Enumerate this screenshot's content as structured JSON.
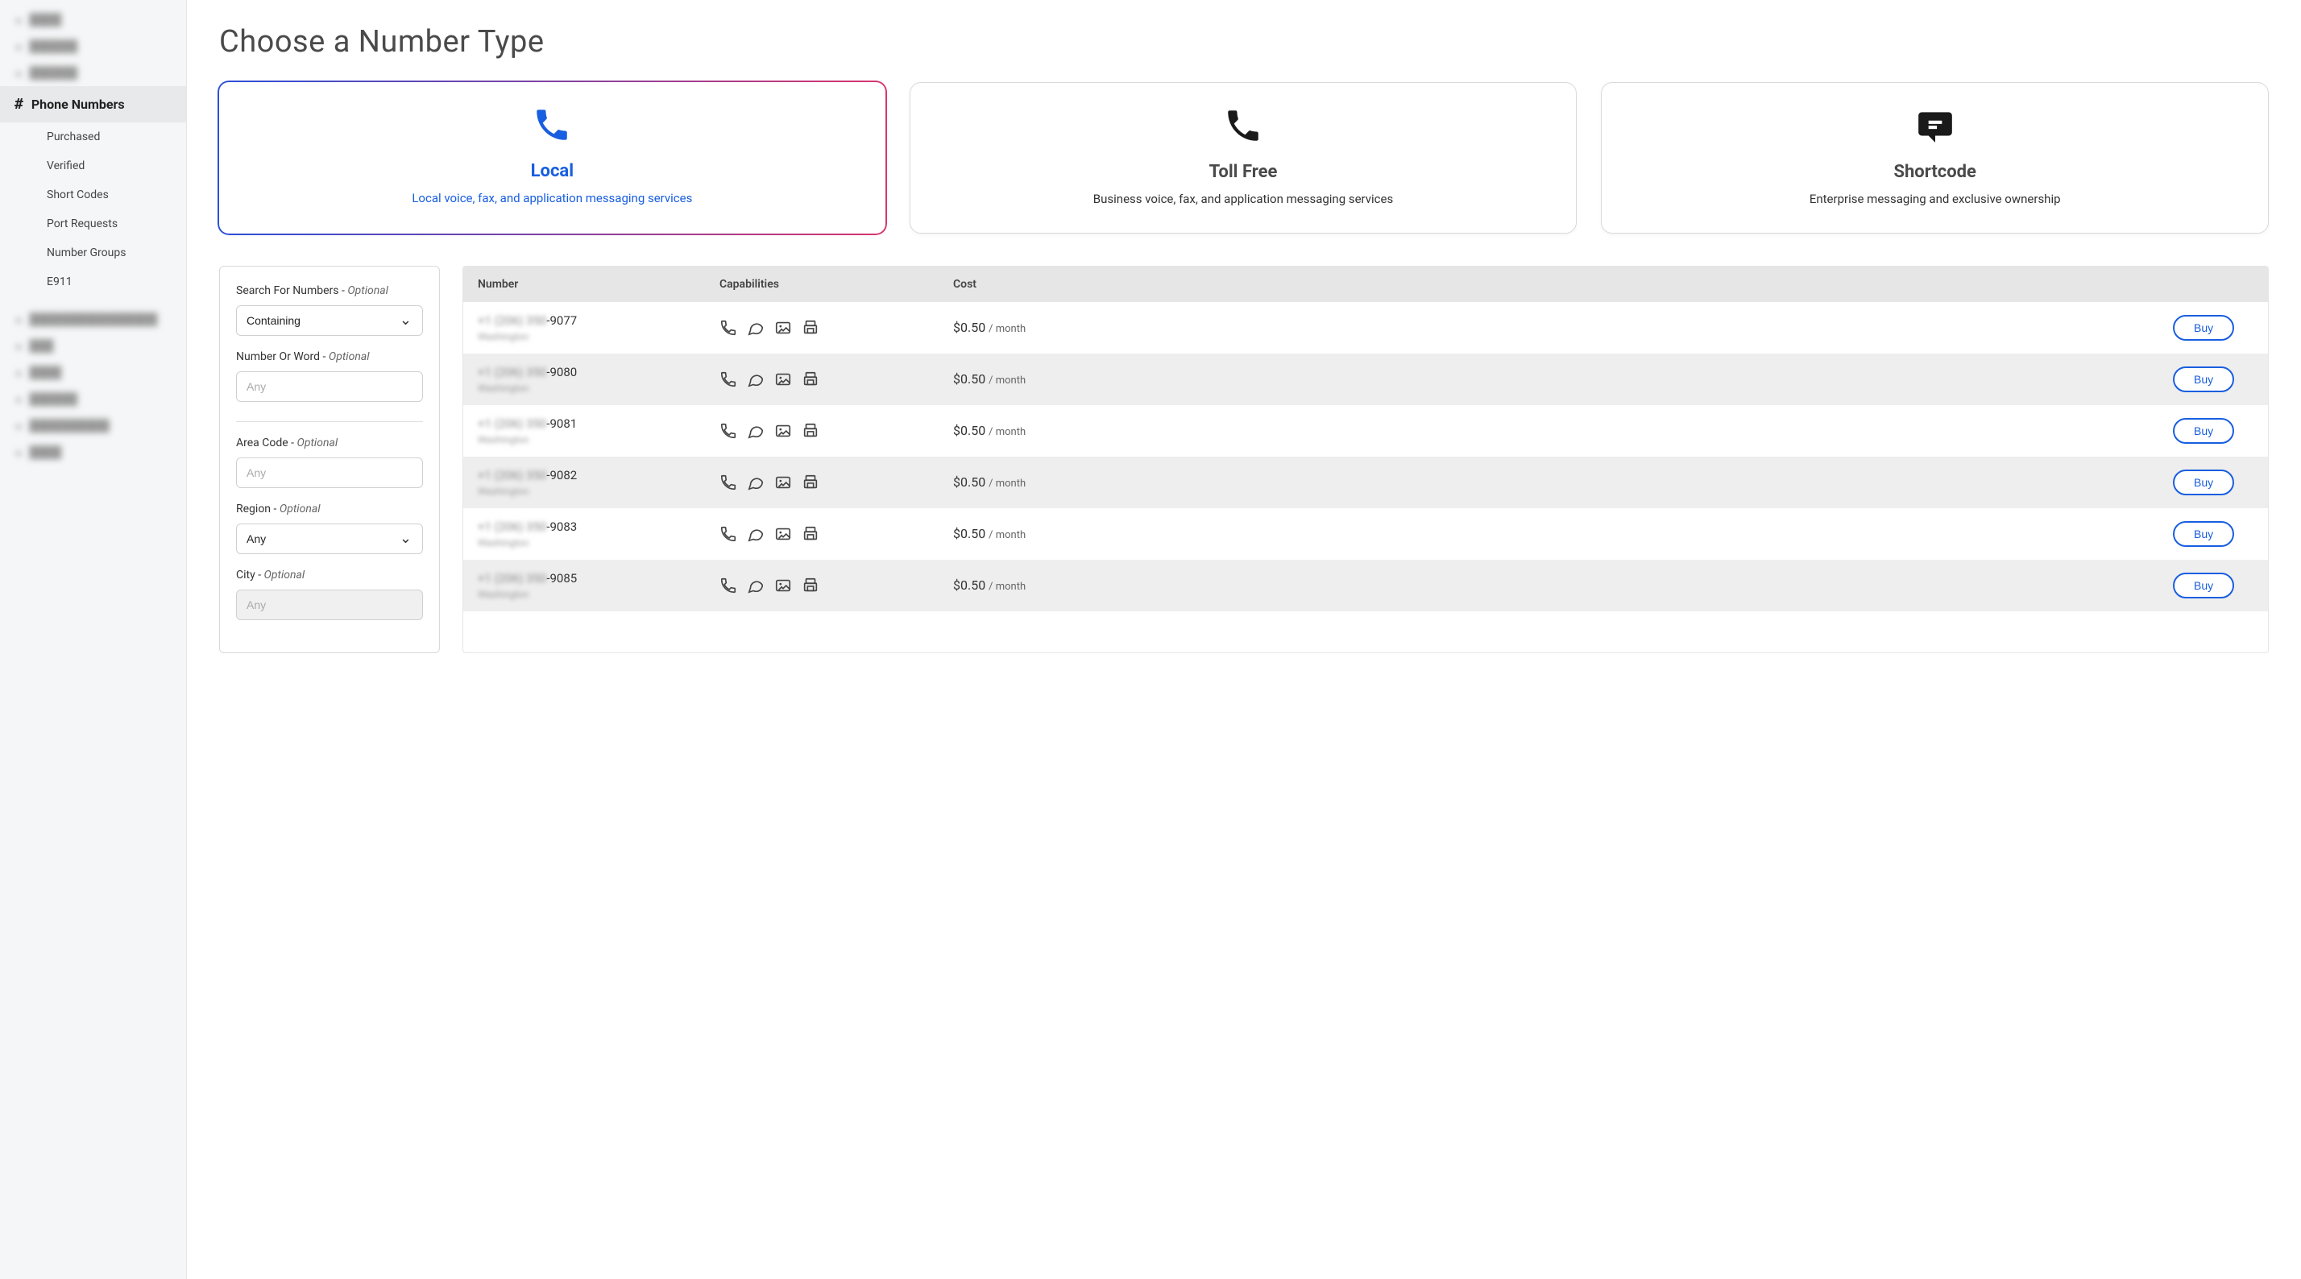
{
  "sidebar": {
    "active_section": "Phone Numbers",
    "sub_items": [
      "Purchased",
      "Verified",
      "Short Codes",
      "Port Requests",
      "Number Groups",
      "E911"
    ]
  },
  "page": {
    "title": "Choose a Number Type"
  },
  "cards": [
    {
      "title": "Local",
      "desc": "Local voice, fax, and application messaging services",
      "icon": "phone",
      "active": true
    },
    {
      "title": "Toll Free",
      "desc": "Business voice, fax, and application messaging services",
      "icon": "phone",
      "active": false
    },
    {
      "title": "Shortcode",
      "desc": "Enterprise messaging and exclusive ownership",
      "icon": "message",
      "active": false
    }
  ],
  "filter": {
    "search_label": "Search For Numbers - ",
    "search_optional": "Optional",
    "search_mode": "Containing",
    "number_label": "Number Or Word - ",
    "number_optional": "Optional",
    "number_placeholder": "Any",
    "area_label": "Area Code - ",
    "area_optional": "Optional",
    "area_placeholder": "Any",
    "region_label": "Region - ",
    "region_optional": "Optional",
    "region_value": "Any",
    "city_label": "City - ",
    "city_optional": "Optional",
    "city_placeholder": "Any"
  },
  "table": {
    "headers": {
      "number": "Number",
      "caps": "Capabilities",
      "cost": "Cost"
    },
    "rows": [
      {
        "suffix": "-9077",
        "price": "$0.50",
        "per": "/ month",
        "buy": "Buy"
      },
      {
        "suffix": "-9080",
        "price": "$0.50",
        "per": "/ month",
        "buy": "Buy"
      },
      {
        "suffix": "-9081",
        "price": "$0.50",
        "per": "/ month",
        "buy": "Buy"
      },
      {
        "suffix": "-9082",
        "price": "$0.50",
        "per": "/ month",
        "buy": "Buy"
      },
      {
        "suffix": "-9083",
        "price": "$0.50",
        "per": "/ month",
        "buy": "Buy"
      },
      {
        "suffix": "-9085",
        "price": "$0.50",
        "per": "/ month",
        "buy": "Buy"
      }
    ]
  }
}
